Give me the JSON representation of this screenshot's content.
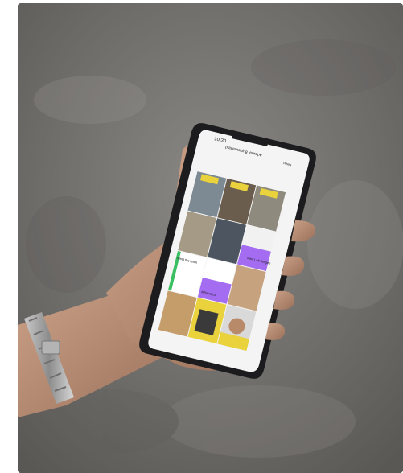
{
  "photo": {
    "subject": "hand holding smartphone showing instagram profile grid",
    "background_color": "#7d7b77",
    "phone_status_time": "10:30",
    "profile_handle": "placemaking_europe",
    "follow_button_label": "Reels",
    "tile_texts": {
      "tile_new_lab": "New Lab Bergen",
      "tile_hashtag": "#Placetics",
      "tile_meet": "Meet the team"
    },
    "accent_colors": {
      "yellow": "#e9d23c",
      "purple": "#a46cf0",
      "green": "#3bbf63"
    }
  }
}
